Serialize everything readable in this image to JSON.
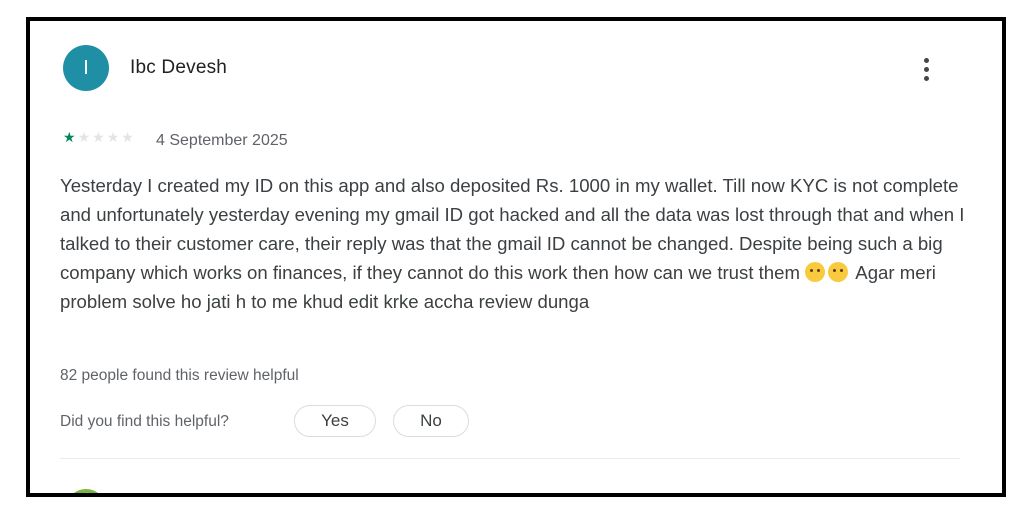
{
  "review": {
    "author": {
      "initial": "I",
      "name": "Ibc Devesh",
      "avatar_color": "#1f8fa6"
    },
    "menu_icon": "more-vert-icon",
    "rating": {
      "value": 1,
      "max": 5,
      "filled_color": "#01875f",
      "empty_color": "#e4e4e4"
    },
    "date": "4 September 2025",
    "text_part1": "Yesterday I created my ID on this app and also deposited Rs. 1000 in my wallet. Till now KYC is not complete and unfortunately yesterday evening my gmail ID got hacked and all the data was lost through that and when I talked to their customer care, their reply was that the gmail ID cannot be changed. Despite being such a big company which works on finances, if they cannot do this work then how can we trust them",
    "emojis": [
      "pleading-face-emoji",
      "crying-face-emoji"
    ],
    "text_part2": "Agar meri problem solve ho jati h to me khud edit krke accha review dunga",
    "helpful_count_text": "82 people found this review helpful",
    "helpful_question": "Did you find this helpful?",
    "yes_label": "Yes",
    "no_label": "No"
  },
  "next_review": {
    "avatar_color": "#7cb342"
  }
}
